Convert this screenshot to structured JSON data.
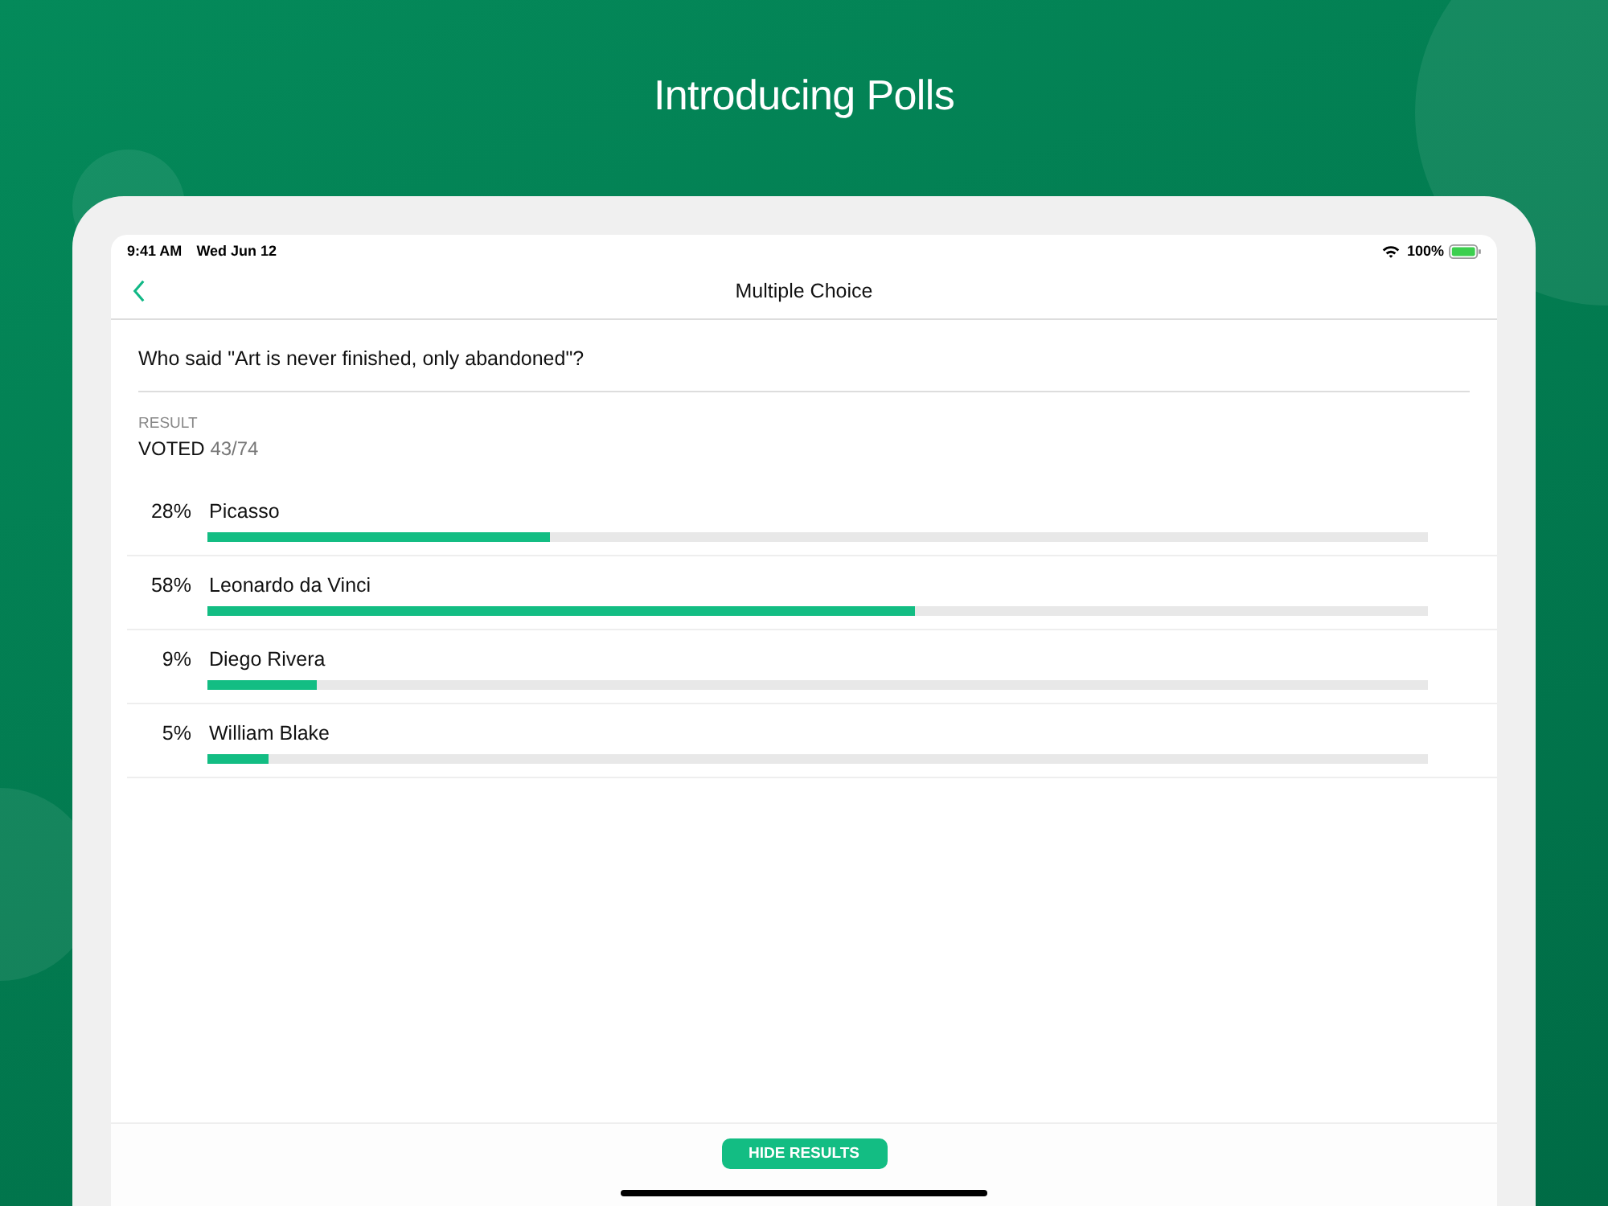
{
  "headline": "Introducing Polls",
  "status_bar": {
    "time": "9:41 AM",
    "date": "Wed Jun 12",
    "battery": "100%"
  },
  "nav": {
    "title": "Multiple Choice"
  },
  "question": "Who said \"Art is never finished, only abandoned\"?",
  "result": {
    "label": "RESULT",
    "voted_label": "VOTED",
    "voted_count": "43/74"
  },
  "options": [
    {
      "percent": "28%",
      "name": "Picasso",
      "level": 0.28
    },
    {
      "percent": "58%",
      "name": "Leonardo da Vinci",
      "level": 0.58
    },
    {
      "percent": "9%",
      "name": "Diego Rivera",
      "level": 0.09
    },
    {
      "percent": "5%",
      "name": "William Blake",
      "level": 0.05
    }
  ],
  "button": "HIDE RESULTS"
}
